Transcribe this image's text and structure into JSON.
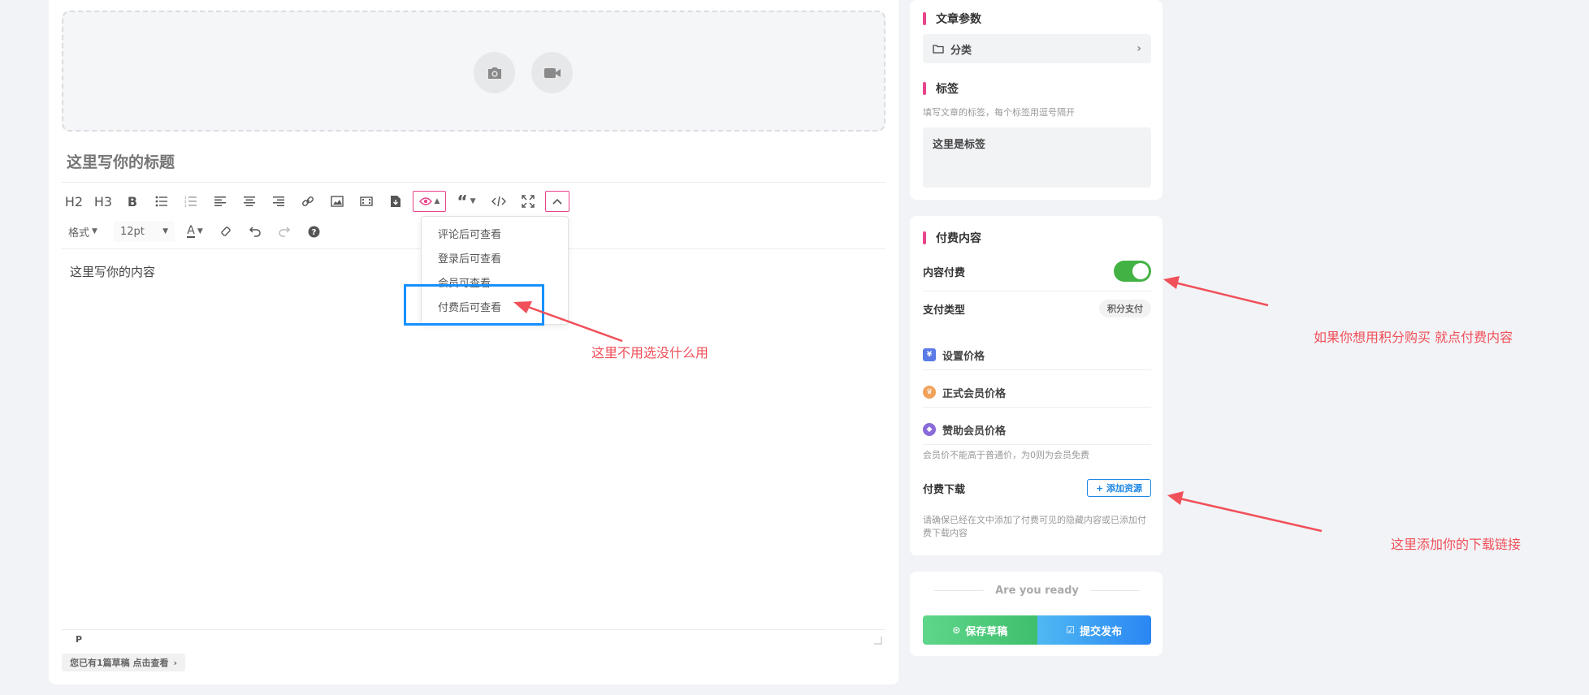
{
  "editor": {
    "title_placeholder": "这里写你的标题",
    "content_text": "这里写你的内容",
    "toolbar": {
      "h2": "H2",
      "h3": "H3",
      "bold": "B",
      "format_select": "格式",
      "font_size_select": "12pt",
      "font_color": "A"
    },
    "hide_menu_items": [
      "评论后可查看",
      "登录后可查看",
      "会员可查看",
      "付费后可查看"
    ],
    "status_tag": "P",
    "draft_notice": "您已有1篇草稿 点击查看",
    "draft_chevron": "›"
  },
  "annotations": {
    "dropdown_note": "这里不用选没什么用",
    "pay_note": "如果你想用积分购买 就点付费内容",
    "download_note": "这里添加你的下载链接",
    "color": "#f0505a",
    "highlight_color": "#1690ff"
  },
  "sidebar": {
    "article_params": {
      "title": "文章参数",
      "category_label": "分类",
      "category_chevron": "›"
    },
    "tags": {
      "title": "标签",
      "hint": "填写文章的标签，每个标签用逗号隔开",
      "value": "这里是标签"
    },
    "paid": {
      "title": "付费内容",
      "toggle_label": "内容付费",
      "toggle_on": true,
      "pay_type_label": "支付类型",
      "pay_type_value": "积分支付",
      "set_price_label": "设置价格",
      "member_price_label": "正式会员价格",
      "sponsor_price_label": "赞助会员价格",
      "member_price_note": "会员价不能高于普通价，为0则为会员免费",
      "download_label": "付费下载",
      "add_resource_btn": "+ 添加资源",
      "download_note": "请确保已经在文中添加了付费可见的隐藏内容或已添加付费下载内容"
    },
    "submit": {
      "ready_text": "Are you ready",
      "save_draft_btn": "保存草稿",
      "publish_btn": "提交发布"
    }
  },
  "colors": {
    "accent_pink": "#e8448b",
    "toggle_green": "#43b244",
    "link_blue": "#1e88e5"
  }
}
